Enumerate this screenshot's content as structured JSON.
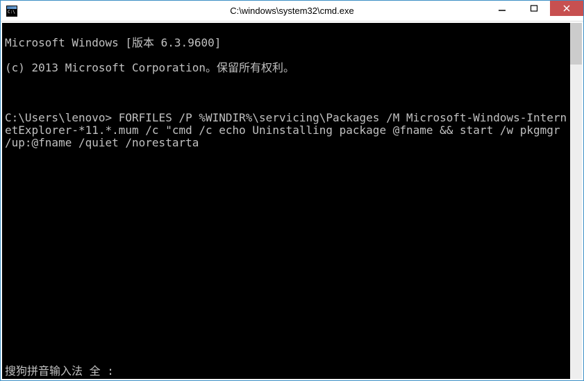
{
  "window": {
    "title": "C:\\windows\\system32\\cmd.exe"
  },
  "terminal": {
    "line1": "Microsoft Windows [版本 6.3.9600]",
    "line2": "(c) 2013 Microsoft Corporation。保留所有权利。",
    "line3": "C:\\Users\\lenovo> FORFILES /P %WINDIR%\\servicing\\Packages /M Microsoft-Windows-InternetExplorer-*11.*.mum /c \"cmd /c echo Uninstalling package @fname && start /w pkgmgr /up:@fname /quiet /norestarta",
    "ime": "搜狗拼音输入法 全 :"
  }
}
